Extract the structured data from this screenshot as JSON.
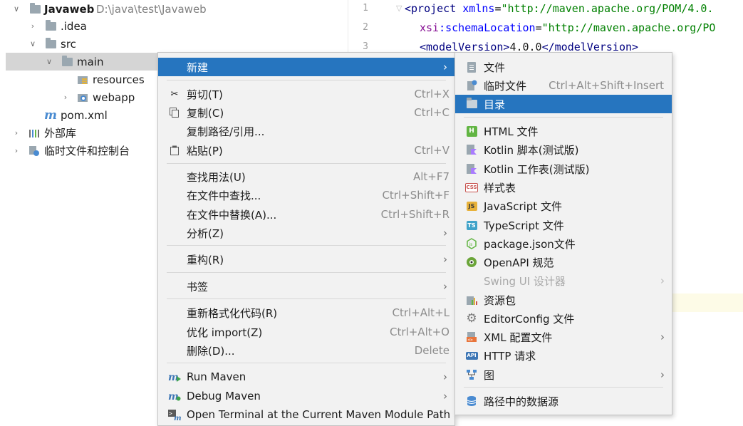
{
  "tree": {
    "root": {
      "name": "Javaweb",
      "path": "D:\\java\\test\\Javaweb"
    },
    "idea": ".idea",
    "src": "src",
    "main": "main",
    "resources": "resources",
    "webapp": "webapp",
    "pom": "pom.xml",
    "external_libs": "外部库",
    "scratches": "临时文件和控制台"
  },
  "editor": {
    "lines": [
      "1",
      "2",
      "3"
    ],
    "line1": {
      "lt": "<",
      "tag": "project",
      "attr": " xmlns",
      "eq": "=",
      "val": "\"http://maven.apache.org/POM/4.0."
    },
    "line2": {
      "ns": "xsi",
      "colon": ":",
      "attr": "schemaLocation",
      "eq": "=",
      "val": "\"http://maven.apache.org/PO"
    },
    "line3": {
      "open": "<modelVersion>",
      "value": "4.0.0",
      "close": "</modelVersion>"
    }
  },
  "context_menu": {
    "new": "新建",
    "cut": {
      "label": "剪切(T)",
      "shortcut": "Ctrl+X"
    },
    "copy": {
      "label": "复制(C)",
      "shortcut": "Ctrl+C"
    },
    "copy_path": "复制路径/引用...",
    "paste": {
      "label": "粘贴(P)",
      "shortcut": "Ctrl+V"
    },
    "find_usages": {
      "label": "查找用法(U)",
      "shortcut": "Alt+F7"
    },
    "find_in_files": {
      "label": "在文件中查找...",
      "shortcut": "Ctrl+Shift+F"
    },
    "replace_in_files": {
      "label": "在文件中替换(A)...",
      "shortcut": "Ctrl+Shift+R"
    },
    "analyze": "分析(Z)",
    "refactor": "重构(R)",
    "bookmarks": "书签",
    "reformat": {
      "label": "重新格式化代码(R)",
      "shortcut": "Ctrl+Alt+L"
    },
    "optimize_imports": {
      "label": "优化 import(Z)",
      "shortcut": "Ctrl+Alt+O"
    },
    "delete": {
      "label": "删除(D)...",
      "shortcut": "Delete"
    },
    "run_maven": "Run Maven",
    "debug_maven": "Debug Maven",
    "open_terminal": "Open Terminal at the Current Maven Module Path"
  },
  "submenu": {
    "file": "文件",
    "scratch": {
      "label": "临时文件",
      "shortcut": "Ctrl+Alt+Shift+Insert"
    },
    "directory": "目录",
    "html": "HTML 文件",
    "kotlin_script": "Kotlin 脚本(测试版)",
    "kotlin_worksheet": "Kotlin 工作表(测试版)",
    "stylesheet": "样式表",
    "javascript": "JavaScript 文件",
    "typescript": "TypeScript 文件",
    "package_json": "package.json文件",
    "openapi": "OpenAPI 规范",
    "swing_ui": "Swing UI 设计器",
    "resource_bundle": "资源包",
    "editorconfig": "EditorConfig 文件",
    "xml_config": "XML 配置文件",
    "http_request": "HTTP 请求",
    "diagram": "图",
    "data_source": "路径中的数据源"
  },
  "icon_text": {
    "html": "H",
    "css": "CSS",
    "js": "JS",
    "ts": "TS",
    "api": "API",
    "m": "m"
  },
  "colors": {
    "highlight": "#2675bf",
    "menu_bg": "#f2f2f2",
    "tree_selected": "#d5d5d5"
  }
}
